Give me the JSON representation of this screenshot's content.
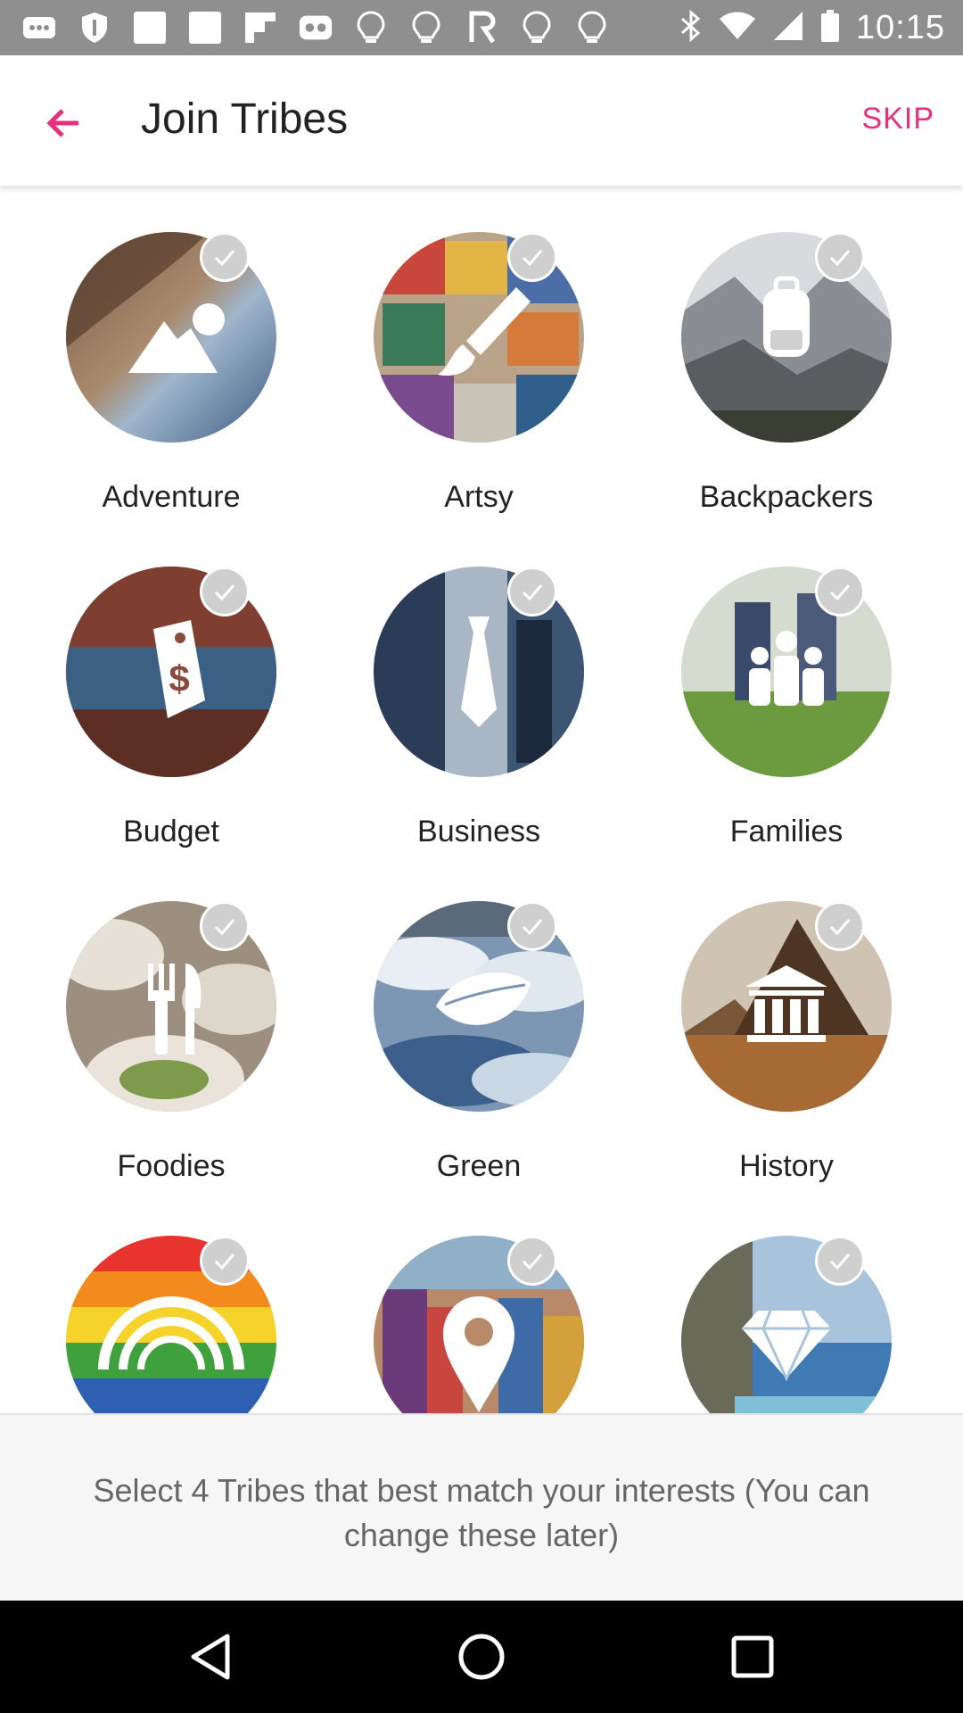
{
  "status_bar": {
    "time": "10:15",
    "left_icons": [
      "more-dots-icon",
      "shield-icon",
      "square-icon",
      "square-icon",
      "flipboard-icon",
      "game-icon",
      "lightbulb-icon",
      "lightbulb-icon",
      "r-icon",
      "lightbulb-icon",
      "lightbulb-icon"
    ],
    "right_icons": [
      "bluetooth-icon",
      "wifi-icon",
      "signal-icon",
      "battery-icon"
    ]
  },
  "app_bar": {
    "title": "Join Tribes",
    "skip_label": "SKIP",
    "accent_color": "#e6307b"
  },
  "tribes": [
    {
      "label": "Adventure",
      "icon": "mountain-icon",
      "selected": false
    },
    {
      "label": "Artsy",
      "icon": "paintbrush-icon",
      "selected": false
    },
    {
      "label": "Backpackers",
      "icon": "backpack-icon",
      "selected": false
    },
    {
      "label": "Budget",
      "icon": "price-tag-icon",
      "selected": false
    },
    {
      "label": "Business",
      "icon": "necktie-icon",
      "selected": false
    },
    {
      "label": "Families",
      "icon": "family-icon",
      "selected": false
    },
    {
      "label": "Foodies",
      "icon": "fork-knife-icon",
      "selected": false
    },
    {
      "label": "Green",
      "icon": "leaf-icon",
      "selected": false
    },
    {
      "label": "History",
      "icon": "museum-icon",
      "selected": false
    },
    {
      "label": "",
      "icon": "rainbow-icon",
      "selected": false
    },
    {
      "label": "",
      "icon": "location-pin-icon",
      "selected": false
    },
    {
      "label": "",
      "icon": "diamond-icon",
      "selected": false
    }
  ],
  "hint": "Select 4 Tribes that best match your interests (You can change these later)",
  "nav_bar": {
    "buttons": [
      "back-triangle-icon",
      "home-circle-icon",
      "recents-square-icon"
    ]
  }
}
